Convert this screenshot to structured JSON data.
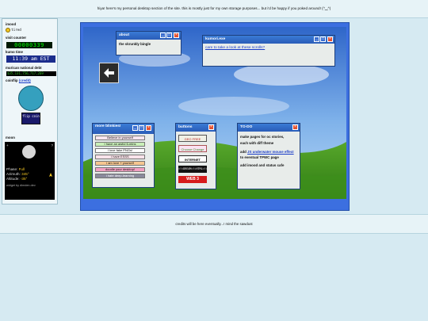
{
  "banner": {
    "text": "hiya! here's my personal desktop section of the site. this is mostly just for my own storage purposes... but i'd be happy if you poked around! (^‿^)"
  },
  "sidebar": {
    "mood_label": "imood",
    "mood_value": "tired",
    "visit_label": "visit counter",
    "visit_value": "00000339",
    "time_label": "kumo time",
    "time_value": "11:39 am EST",
    "debt_label": "murican national debt",
    "debt_value": "$35,131,756,717,269",
    "coinflip_label": "coinflip",
    "coinflip_credit": "(credit)",
    "coinflip_button": "flip coin",
    "moon_label": "moon",
    "moon": {
      "plus": "+",
      "question": "?",
      "phase_key": "Phase:",
      "phase_val": "Full",
      "azimuth_key": "Azimuth:",
      "azimuth_val": "345°",
      "altitude_key": "Altitude:",
      "altitude_val": "-35°",
      "credit": "widget by dimden.dev"
    }
  },
  "windows": {
    "about": {
      "title": "about",
      "body": "the skrunkly bingle"
    },
    "kumori": {
      "title": "kumori.exe",
      "link": "care to take a look at these scrolls?"
    },
    "more_blinkies": {
      "title": "more blinkies!",
      "items": [
        "Believe in yourself",
        "I have an awful 6-mins",
        "I love fake PNGs!",
        "i have ESSS",
        "i am love + yourself",
        "doodle your desktop!",
        "i hate deep-learning"
      ]
    },
    "buttons": {
      "title": "buttons",
      "items": [
        "GEO FREE",
        "Choose Change",
        "INTERNET ARCHIVE",
        "=!=DREAM=!=HTML=!=",
        "WEB 3"
      ]
    },
    "todo": {
      "title": "TO-DO",
      "lines": [
        "make pages for oc stories,",
        "each with diff theme",
        "add",
        "JS underwater mouse effect",
        "to eventual TPWC",
        "page",
        "add imood and status cafe"
      ]
    }
  },
  "footer": {
    "text": "credits will be here eventually...! mind the sawdust"
  },
  "colors": {
    "desktop": "#3c6fe0",
    "titlebar": "#2a5cb8",
    "close": "#e3502f",
    "link": "#1a3cc7",
    "background": "#d6eaf2"
  }
}
